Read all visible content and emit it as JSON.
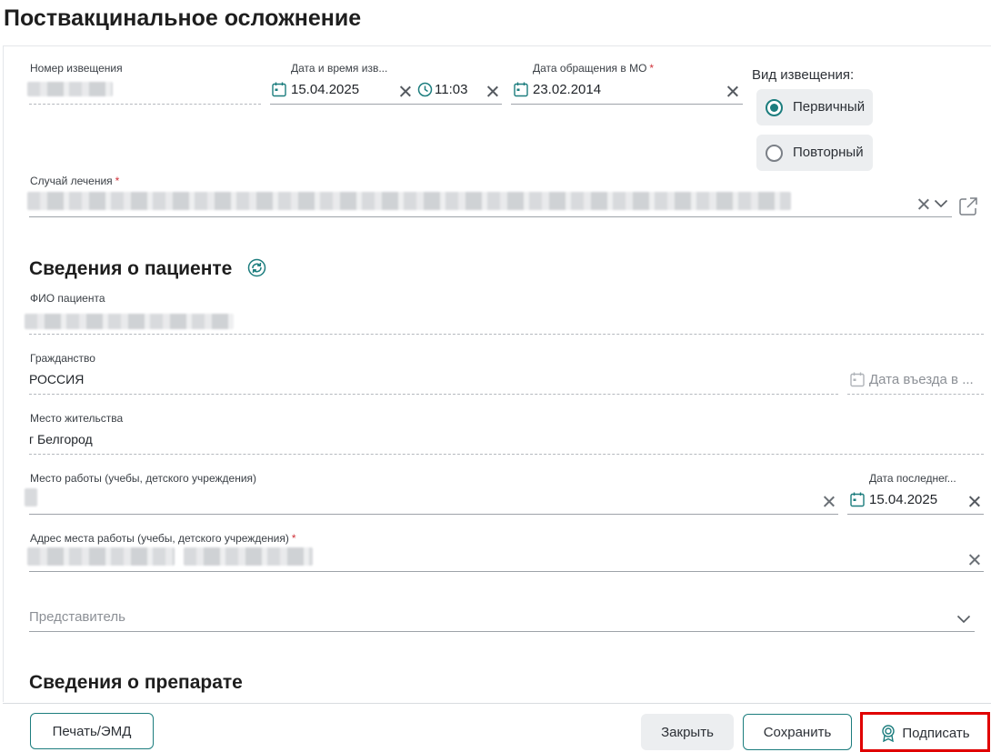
{
  "page": {
    "title": "Поствакцинальное осложнение"
  },
  "form": {
    "notice_number": {
      "label": "Номер извещения"
    },
    "datetime": {
      "label": "Дата и время изв...",
      "date": "15.04.2025",
      "time": "11:03"
    },
    "visit_date": {
      "label": "Дата обращения в МО",
      "required_mark": "*",
      "value": "23.02.2014"
    },
    "notice_type": {
      "label": "Вид извещения:",
      "options": [
        {
          "label": "Первичный",
          "checked": true
        },
        {
          "label": "Повторный",
          "checked": false
        }
      ]
    },
    "treatment_case": {
      "label": "Случай лечения",
      "required_mark": "*"
    }
  },
  "patient": {
    "section_title": "Сведения о пациенте",
    "full_name": {
      "label": "ФИО пациента"
    },
    "citizenship": {
      "label": "Гражданство",
      "value": "РОССИЯ"
    },
    "entry_date": {
      "placeholder": "Дата въезда в ..."
    },
    "residence": {
      "label": "Место жительства",
      "value": "г Белгород"
    },
    "workplace": {
      "label": "Место работы (учебы, детского учреждения)"
    },
    "last_date": {
      "label": "Дата последнег...",
      "value": "15.04.2025"
    },
    "work_address": {
      "label": "Адрес места работы (учебы, детского учреждения)",
      "required_mark": "*"
    },
    "representative": {
      "placeholder": "Представитель"
    }
  },
  "drug": {
    "section_title": "Сведения о препарате"
  },
  "footer": {
    "print_label": "Печать/ЭМД",
    "close_label": "Закрыть",
    "save_label": "Сохранить",
    "sign_label": "Подписать"
  },
  "colors": {
    "accent": "#1c7d7e",
    "highlight": "#e00000",
    "required": "#d0323a"
  },
  "icons": [
    "calendar-icon",
    "clock-icon",
    "clear-icon",
    "chevron-down-icon",
    "external-link-icon",
    "refresh-icon",
    "signature-icon"
  ]
}
